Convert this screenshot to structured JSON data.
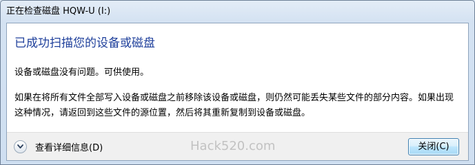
{
  "window": {
    "title": "正在检查磁盘 HQW-U (I:)"
  },
  "content": {
    "main_instruction": "已成功扫描您的设备或磁盘",
    "status_text": "设备或磁盘没有问题。可供使用。",
    "detail_text": "如果在将所有文件全部写入设备或磁盘之前移除该设备或磁盘，则仍然可能丢失某些文件的部分内容。如果出现这种情况，请返回到这些文件的源位置，然后将其重新复制到设备或磁盘。"
  },
  "footer": {
    "details_toggle_label": "查看详细信息(D)",
    "details_icon": "chevron-down-icon",
    "watermark": "Hack520.com",
    "close_label": "关闭(C)"
  },
  "colors": {
    "main_instruction": "#1e3f9b",
    "watermark": "#c2c2c2"
  }
}
